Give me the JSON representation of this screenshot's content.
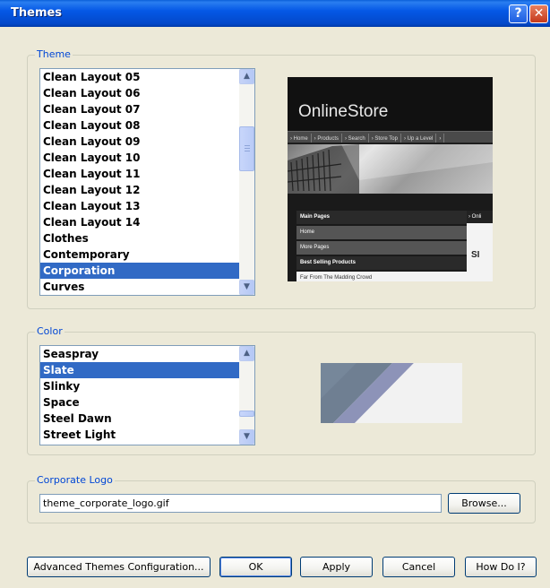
{
  "window": {
    "title": "Themes",
    "help_label": "?",
    "close_label": "✕"
  },
  "theme_group": {
    "legend": "Theme",
    "items": [
      {
        "label": "Clean Layout 05",
        "selected": false
      },
      {
        "label": "Clean Layout 06",
        "selected": false
      },
      {
        "label": "Clean Layout 07",
        "selected": false
      },
      {
        "label": "Clean Layout 08",
        "selected": false
      },
      {
        "label": "Clean Layout 09",
        "selected": false
      },
      {
        "label": "Clean Layout 10",
        "selected": false
      },
      {
        "label": "Clean Layout 11",
        "selected": false
      },
      {
        "label": "Clean Layout 12",
        "selected": false
      },
      {
        "label": "Clean Layout 13",
        "selected": false
      },
      {
        "label": "Clean Layout 14",
        "selected": false
      },
      {
        "label": "Clothes",
        "selected": false
      },
      {
        "label": "Contemporary",
        "selected": false
      },
      {
        "label": "Corporation",
        "selected": true
      },
      {
        "label": "Curves",
        "selected": false
      }
    ],
    "preview": {
      "logo": "OnlineStore",
      "nav": [
        "› Home",
        "› Products",
        "› Search",
        "› Store Top",
        "› Up a Level",
        "›"
      ],
      "side_header": "Main Pages",
      "side_items": [
        "Home",
        "More Pages"
      ],
      "best_selling": "Best Selling Products",
      "product": "Far From The Madding Crowd",
      "main_head": "› Onli",
      "main_text": "SI"
    }
  },
  "color_group": {
    "legend": "Color",
    "items": [
      {
        "label": "Seaspray",
        "selected": false
      },
      {
        "label": "Slate",
        "selected": true
      },
      {
        "label": "Slinky",
        "selected": false
      },
      {
        "label": "Space",
        "selected": false
      },
      {
        "label": "Steel Dawn",
        "selected": false
      },
      {
        "label": "Street Light",
        "selected": false
      }
    ],
    "swatch_colors": [
      "#6f7f92",
      "#8d93b8",
      "#f2f2f2"
    ]
  },
  "logo_group": {
    "legend": "Corporate Logo",
    "value": "theme_corporate_logo.gif",
    "browse_label": "Browse..."
  },
  "buttons": {
    "advanced": "Advanced Themes Configuration...",
    "ok": "OK",
    "apply": "Apply",
    "cancel": "Cancel",
    "help": "How Do I?"
  }
}
